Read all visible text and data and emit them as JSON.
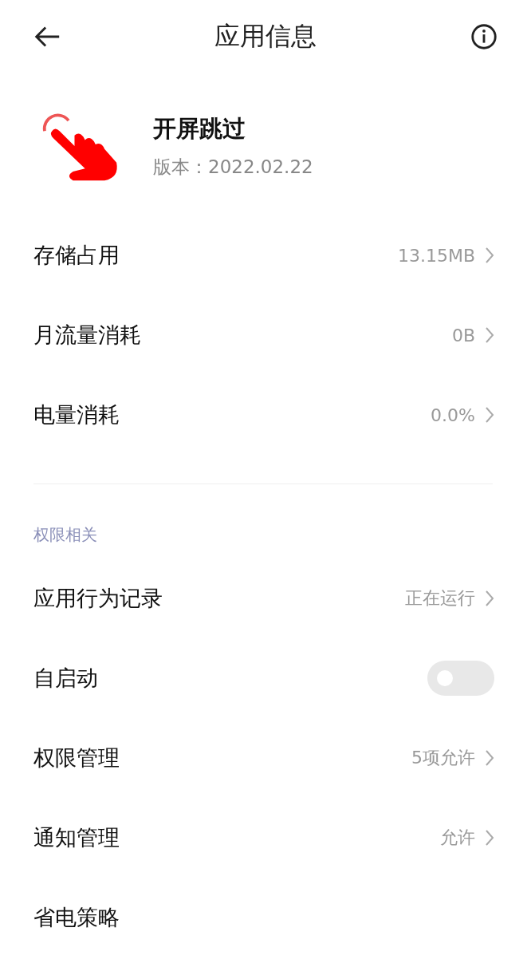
{
  "header": {
    "title": "应用信息"
  },
  "app": {
    "name": "开屏跳过",
    "version": "版本：2022.02.22"
  },
  "usage": [
    {
      "kind": "link",
      "label": "存储占用",
      "value": "13.15MB"
    },
    {
      "kind": "link",
      "label": "月流量消耗",
      "value": "0B"
    },
    {
      "kind": "link",
      "label": "电量消耗",
      "value": "0.0%"
    }
  ],
  "permissions": {
    "heading": "权限相关",
    "rows": [
      {
        "kind": "link",
        "label": "应用行为记录",
        "value": "正在运行"
      },
      {
        "kind": "toggle",
        "label": "自启动",
        "on": false
      },
      {
        "kind": "link",
        "label": "权限管理",
        "value": "5项允许"
      },
      {
        "kind": "link",
        "label": "通知管理",
        "value": "允许"
      },
      {
        "kind": "plain",
        "label": "省电策略"
      }
    ]
  }
}
